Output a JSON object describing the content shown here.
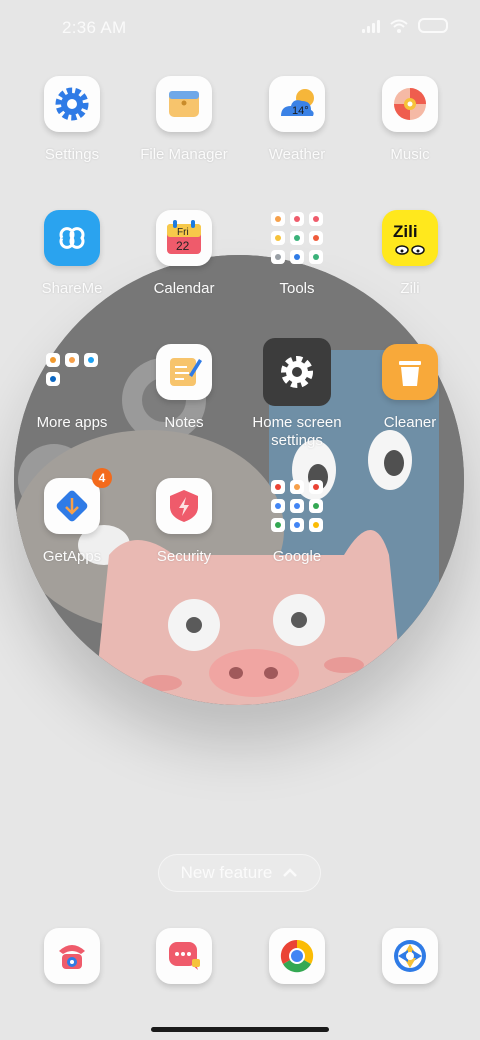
{
  "status": {
    "time": "2:36 AM"
  },
  "apps": [
    {
      "label": "Settings"
    },
    {
      "label": "File Manager"
    },
    {
      "label": "Weather",
      "temp": "14°"
    },
    {
      "label": "Music"
    },
    {
      "label": "ShareMe"
    },
    {
      "label": "Calendar",
      "day": "Fri",
      "date": "22"
    },
    {
      "label": "Tools"
    },
    {
      "label": "Zili",
      "logo_text": "Zili"
    },
    {
      "label": "More apps"
    },
    {
      "label": "Notes"
    },
    {
      "label": "Home screen settings"
    },
    {
      "label": "Cleaner"
    },
    {
      "label": "GetApps",
      "badge": "4"
    },
    {
      "label": "Security"
    },
    {
      "label": "Google"
    }
  ],
  "new_feature": {
    "label": "New feature"
  },
  "dock": [
    {
      "icon": "phone-icon"
    },
    {
      "icon": "messages-icon"
    },
    {
      "icon": "chrome-icon"
    },
    {
      "icon": "camera-icon"
    }
  ],
  "colors": {
    "accent_blue": "#2f7be6",
    "badge": "#f36a1b"
  }
}
